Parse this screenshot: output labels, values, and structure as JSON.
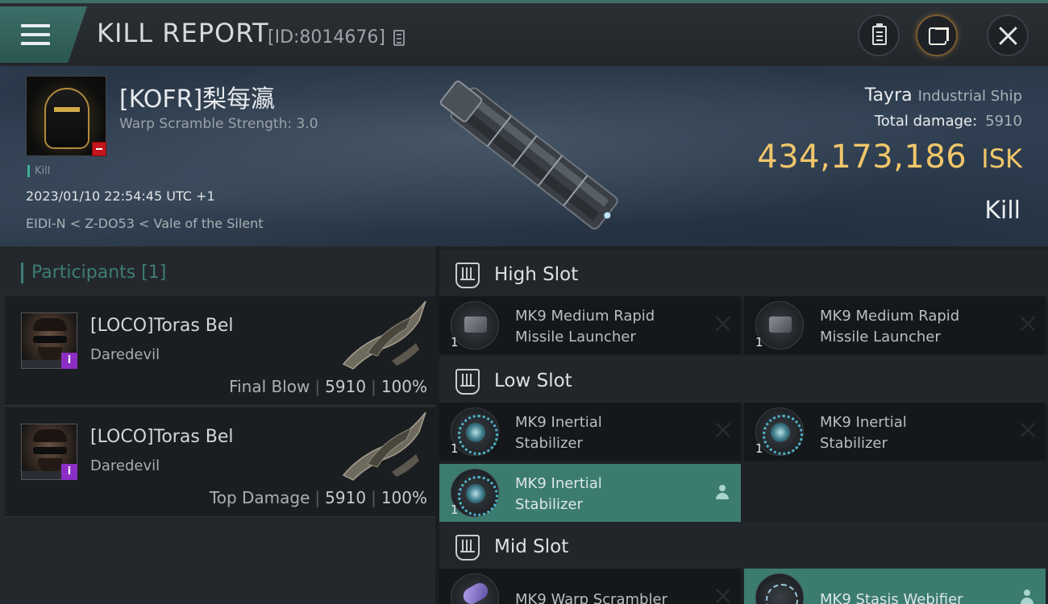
{
  "header": {
    "title": "KILL REPORT",
    "report_id": "[ID:8014676]"
  },
  "victim": {
    "name": "[KOFR]梨每瀛",
    "warp_scramble": "Warp Scramble Strength: 3.0",
    "tag": "Kill",
    "datetime": "2023/01/10 22:54:45 UTC +1",
    "location": "EIDI-N < Z-DO53 < Vale of the Silent"
  },
  "ship": {
    "name": "Tayra",
    "class": "Industrial Ship",
    "total_damage_label": "Total damage:",
    "total_damage_value": "5910",
    "isk_amount": "434,173,186",
    "isk_unit": "ISK",
    "result": "Kill"
  },
  "participants": {
    "header": "Participants [1]",
    "items": [
      {
        "name": "[LOCO]Toras Bel",
        "ship": "Daredevil",
        "role": "Final Blow",
        "damage": "5910",
        "percent": "100%"
      },
      {
        "name": "[LOCO]Toras Bel",
        "ship": "Daredevil",
        "role": "Top Damage",
        "damage": "5910",
        "percent": "100%"
      }
    ]
  },
  "fitting": {
    "high": {
      "label": "High Slot",
      "modules": [
        {
          "line1": "MK9 Medium Rapid",
          "line2": "Missile Launcher",
          "qty": "1",
          "icon": "missile-launcher-icon"
        },
        {
          "line1": "MK9 Medium Rapid",
          "line2": "Missile Launcher",
          "qty": "1",
          "icon": "missile-launcher-icon"
        }
      ]
    },
    "low": {
      "label": "Low Slot",
      "modules": [
        {
          "line1": "MK9 Inertial",
          "line2": "Stabilizer",
          "qty": "1",
          "icon": "inertial-stabilizer-icon"
        },
        {
          "line1": "MK9 Inertial",
          "line2": "Stabilizer",
          "qty": "1",
          "icon": "inertial-stabilizer-icon"
        },
        {
          "line1": "MK9 Inertial",
          "line2": "Stabilizer",
          "qty": "1",
          "icon": "inertial-stabilizer-icon"
        }
      ]
    },
    "mid": {
      "label": "Mid Slot",
      "modules": [
        {
          "line1": "MK9 Warp Scrambler",
          "qty": "",
          "icon": "warp-scrambler-icon"
        },
        {
          "line1": "MK9 Stasis Webifier",
          "qty": "",
          "icon": "stasis-webifier-icon"
        }
      ]
    }
  },
  "colors": {
    "accent_teal": "#3c7b70",
    "isk_gold": "#f1c66a",
    "remove_red": "#c4151c",
    "info_purple": "#8b2fc4"
  }
}
